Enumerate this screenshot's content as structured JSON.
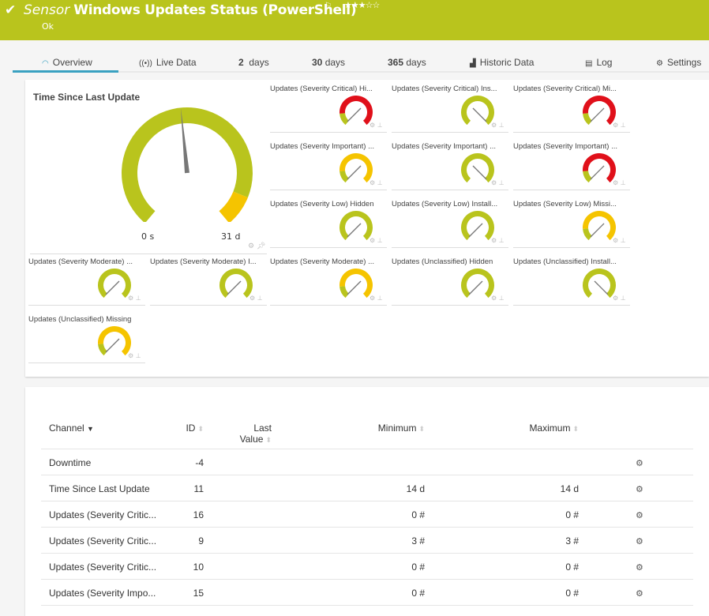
{
  "header": {
    "check_icon": "checkmark-icon",
    "kind": "Sensor",
    "title": "Windows Updates Status (PowerShell)",
    "flag_icon": "flag-icon",
    "stars": "★★★☆☆",
    "priority_stars": 3,
    "status": "Ok",
    "color": "#b9c41d"
  },
  "tabs": [
    {
      "label": "Overview",
      "icon": "gauge-icon",
      "active": true
    },
    {
      "label": "Live Data",
      "icon": "broadcast-icon"
    },
    {
      "num": "2",
      "label": "days"
    },
    {
      "num": "30",
      "label": "days"
    },
    {
      "num": "365",
      "label": "days"
    },
    {
      "label": "Historic Data",
      "icon": "area-chart-icon"
    },
    {
      "label": "Log",
      "icon": "list-icon"
    },
    {
      "label": "Settings",
      "icon": "gear-icon"
    }
  ],
  "main_gauge": {
    "title": "Time Since Last Update",
    "min_label": "0 s",
    "max_label": "31 d",
    "value_fraction": 0.48,
    "warning_from_fraction": 0.9
  },
  "gauges": [
    {
      "title": "Updates (Severity Critical) Hi...",
      "color": "red",
      "needle": "low"
    },
    {
      "title": "Updates (Severity Critical) Ins...",
      "color": "green",
      "needle": "high"
    },
    {
      "title": "Updates (Severity Critical) Mi...",
      "color": "red",
      "needle": "low"
    },
    {
      "title": "Updates (Severity Important) ...",
      "color": "yellow",
      "needle": "low"
    },
    {
      "title": "Updates (Severity Important) ...",
      "color": "green",
      "needle": "high"
    },
    {
      "title": "Updates (Severity Important) ...",
      "color": "red",
      "needle": "low"
    },
    {
      "title": "Updates (Severity Low) Hidden",
      "color": "green",
      "needle": "low"
    },
    {
      "title": "Updates (Severity Low) Install...",
      "color": "green",
      "needle": "low"
    },
    {
      "title": "Updates (Severity Low) Missi...",
      "color": "yellow",
      "needle": "low"
    },
    {
      "title": "Updates (Severity Moderate) ...",
      "color": "green",
      "needle": "low"
    },
    {
      "title": "Updates (Severity Moderate) I...",
      "color": "green",
      "needle": "low"
    },
    {
      "title": "Updates (Severity Moderate) ...",
      "color": "yellow",
      "needle": "low"
    },
    {
      "title": "Updates (Unclassified) Hidden",
      "color": "green",
      "needle": "low"
    },
    {
      "title": "Updates (Unclassified) Install...",
      "color": "green",
      "needle": "high"
    },
    {
      "title": "Updates (Unclassified) Missing",
      "color": "yellow",
      "needle": "low"
    }
  ],
  "colors": {
    "green": "#b9c41d",
    "yellow": "#f5c400",
    "red": "#e0101a",
    "needle": "#777777"
  },
  "table": {
    "headers": {
      "channel": "Channel",
      "id": "ID",
      "last_value_1": "Last",
      "last_value_2": "Value",
      "minimum": "Minimum",
      "maximum": "Maximum"
    },
    "rows": [
      {
        "channel": "Downtime",
        "id": "-4",
        "last": "",
        "min": "",
        "max": ""
      },
      {
        "channel": "Time Since Last Update",
        "id": "11",
        "last": "",
        "min": "14 d",
        "max": "14 d"
      },
      {
        "channel": "Updates (Severity Critic...",
        "id": "16",
        "last": "",
        "min": "0 #",
        "max": "0 #"
      },
      {
        "channel": "Updates (Severity Critic...",
        "id": "9",
        "last": "",
        "min": "3 #",
        "max": "3 #"
      },
      {
        "channel": "Updates (Severity Critic...",
        "id": "10",
        "last": "",
        "min": "0 #",
        "max": "0 #"
      },
      {
        "channel": "Updates (Severity Impo...",
        "id": "15",
        "last": "",
        "min": "0 #",
        "max": "0 #"
      }
    ]
  }
}
